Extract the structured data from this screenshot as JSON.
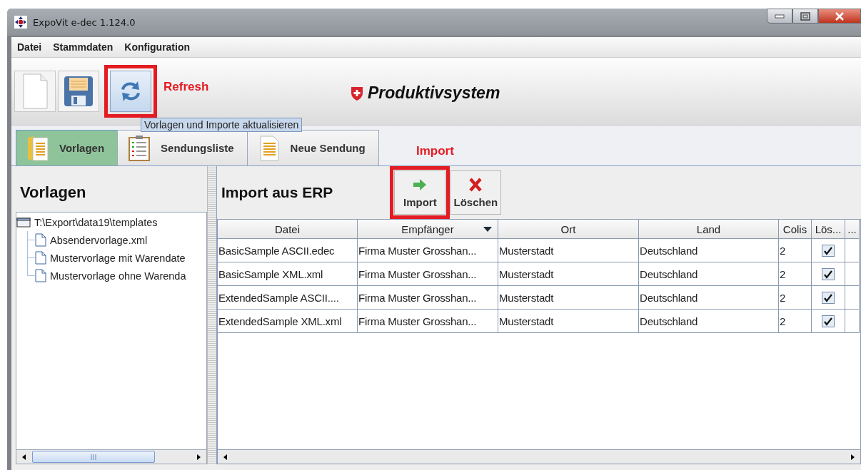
{
  "window": {
    "title": "ExpoVit e-dec 1.124.0"
  },
  "menu": [
    "Datei",
    "Stammdaten",
    "Konfiguration"
  ],
  "toolbar": {
    "buttons": [
      {
        "kind": "new",
        "highlighted": false
      },
      {
        "kind": "save",
        "highlighted": false
      },
      {
        "kind": "refresh",
        "highlighted": true
      }
    ],
    "annotation": "Refresh",
    "tooltip": "Vorlagen und Importe aktualisieren",
    "system_label": "Produktivsystem"
  },
  "tabs": [
    {
      "label": "Vorlagen",
      "kind": "folder",
      "selected": true
    },
    {
      "label": "Sendungsliste",
      "kind": "list",
      "selected": false
    },
    {
      "label": "Neue Sendung",
      "kind": "document",
      "selected": false
    }
  ],
  "templates": {
    "title": "Vorlagen",
    "tree": {
      "label": "T:\\Export\\data19\\templates",
      "children": [
        {
          "label": "Absendervorlage.xml"
        },
        {
          "label": "Mustervorlage mit Warendate"
        },
        {
          "label": "Mustervorlage ohne Warenda"
        }
      ]
    }
  },
  "import": {
    "title": "Import aus ERP",
    "annotation": "Import",
    "actions": [
      {
        "label": "Import",
        "kind": "import",
        "highlighted": true
      },
      {
        "label": "Löschen",
        "kind": "delete",
        "highlighted": false
      }
    ],
    "table": {
      "columns": [
        {
          "label": "Datei",
          "sorted": false
        },
        {
          "label": "Empfänger",
          "sorted": true
        },
        {
          "label": "Ort",
          "sorted": false
        },
        {
          "label": "Land",
          "sorted": false
        },
        {
          "label": "Colis",
          "sorted": false
        },
        {
          "label": "Lös...",
          "sorted": false
        },
        {
          "label": "...",
          "sorted": false
        }
      ],
      "rows": [
        {
          "cells": [
            "BasicSample ASCII.edec",
            "Firma Muster Grosshan...",
            "Musterstadt",
            "Deutschland",
            "2"
          ],
          "delete": true
        },
        {
          "cells": [
            "BasicSample XML.xml",
            "Firma Muster Grosshan...",
            "Musterstadt",
            "Deutschland",
            "2"
          ],
          "delete": true
        },
        {
          "cells": [
            "ExtendedSample ASCII....",
            "Firma Muster Grosshan...",
            "Musterstadt",
            "Deutschland",
            "2"
          ],
          "delete": true
        },
        {
          "cells": [
            "ExtendedSample XML.xml",
            "Firma Muster Grosshan...",
            "Musterstadt",
            "Deutschland",
            "2"
          ],
          "delete": true
        }
      ]
    }
  }
}
